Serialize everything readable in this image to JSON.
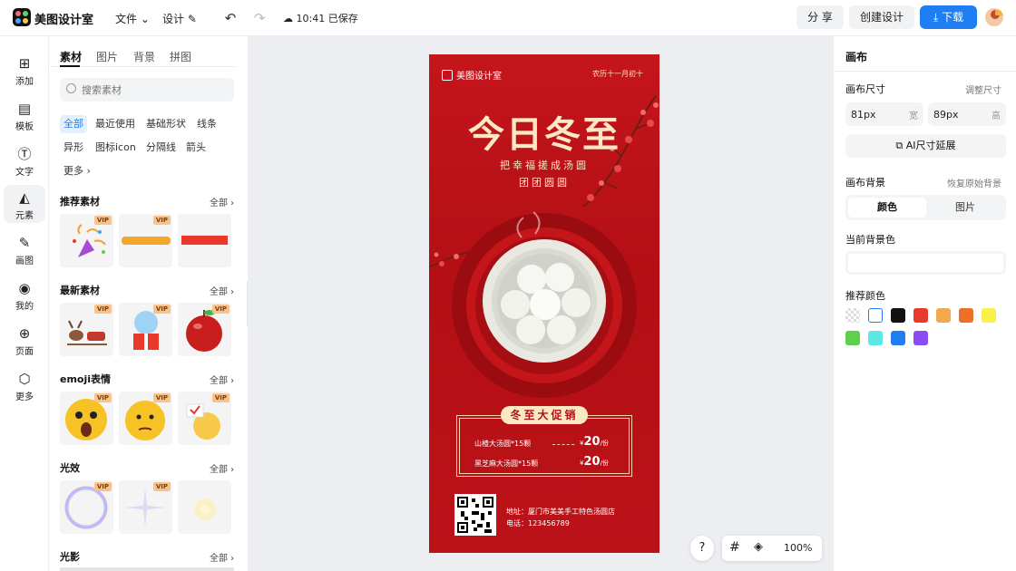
{
  "app": {
    "name": "美图设计室"
  },
  "topbar": {
    "file_menu": "文件",
    "design_menu": "设计",
    "save_status": "10:41 已保存",
    "share_label": "分 享",
    "create_label": "创建设计",
    "download_label": "下载",
    "avatar_badge": "VIP"
  },
  "rail": {
    "items": [
      {
        "label": "添加",
        "icon": "plus-square-icon"
      },
      {
        "label": "模板",
        "icon": "template-icon"
      },
      {
        "label": "文字",
        "icon": "text-icon"
      },
      {
        "label": "元素",
        "icon": "shapes-icon"
      },
      {
        "label": "画图",
        "icon": "draw-icon"
      },
      {
        "label": "我的",
        "icon": "user-icon"
      },
      {
        "label": "页面",
        "icon": "page-add-icon"
      },
      {
        "label": "更多",
        "icon": "cube-icon"
      }
    ],
    "active": "元素"
  },
  "assets": {
    "tabs": [
      "素材",
      "图片",
      "背景",
      "拼图"
    ],
    "search_placeholder": "搜索素材",
    "chips": [
      "全部",
      "最近使用",
      "基础形状",
      "线条",
      "异形",
      "图标icon",
      "分隔线",
      "箭头",
      "更多"
    ],
    "all_label": "全部",
    "vip": "VIP",
    "sections": [
      {
        "title": "推荐素材",
        "items": [
          "party-popper",
          "orange-brush-stroke",
          "red-bar"
        ]
      },
      {
        "title": "最新素材",
        "items": [
          "reindeer-sleigh",
          "snow-globe-gift",
          "red-apple"
        ]
      },
      {
        "title": "emoji表情",
        "items": [
          "shocked-emoji",
          "thinking-emoji",
          "chick-emoji"
        ]
      },
      {
        "title": "光效",
        "items": [
          "bubble",
          "sparkle",
          "glow"
        ]
      },
      {
        "title": "光影",
        "items": []
      }
    ]
  },
  "poster": {
    "brand": "美图设计室",
    "lunar_date": "农历十一月初十",
    "title": "今日冬至",
    "subtitle_1": "把幸福搓成汤圆",
    "subtitle_2": "团团圆圆",
    "promo_tag": "冬至大促销",
    "items": [
      {
        "name": "山楂大汤圆*15颗",
        "price": "20",
        "unit": "/份",
        "currency": "¥"
      },
      {
        "name": "黑芝麻大汤圆*15颗",
        "price": "20",
        "unit": "/份",
        "currency": "¥"
      }
    ],
    "address": "地址：厦门市美美手工特色汤圆店",
    "phone": "电话：123456789",
    "colors": {
      "red": "#c4151b",
      "cream": "#fbe9c6"
    }
  },
  "canvas_toolbar": {
    "help": "?",
    "zoom": "100%"
  },
  "right_panel": {
    "title": "画布",
    "size_label": "画布尺寸",
    "adjust_size": "调整尺寸",
    "width_value": "81px",
    "width_unit": "宽",
    "height_value": "89px",
    "height_unit": "高",
    "ai_extend": "AI尺寸延展",
    "bg_label": "画布背景",
    "restore_bg": "恢复原始背景",
    "bg_tabs": [
      "颜色",
      "图片"
    ],
    "current_bg": "当前背景色",
    "recommended": "推荐颜色",
    "swatches": [
      "transparent",
      "#ffffff",
      "#111111",
      "#e8392b",
      "#f3a94d",
      "#ef6f24",
      "#f7f14a",
      "#5fd04c",
      "#5ce8e5",
      "#1f7ef2",
      "#8a4cf0"
    ]
  }
}
